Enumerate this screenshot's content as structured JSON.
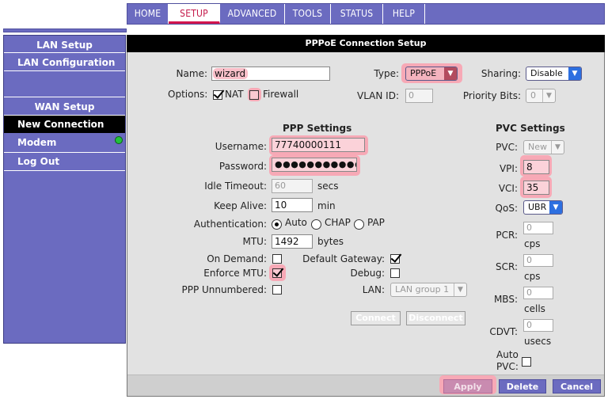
{
  "topnav": {
    "tabs": [
      {
        "label": "HOME"
      },
      {
        "label": "SETUP"
      },
      {
        "label": "ADVANCED"
      },
      {
        "label": "TOOLS"
      },
      {
        "label": "STATUS"
      },
      {
        "label": "HELP"
      }
    ],
    "active_tab": "SETUP"
  },
  "sidebar": {
    "lan_heading": "LAN Setup",
    "lan_configuration": "LAN Configuration",
    "wan_heading": "WAN Setup",
    "new_connection": "New Connection",
    "modem": "Modem",
    "log_out": "Log Out",
    "modem_status_color": "#21c23b"
  },
  "panel": {
    "title": "PPPoE Connection Setup",
    "name_label": "Name:",
    "name_value": "wizard",
    "type_label": "Type:",
    "type_value": "PPPoE",
    "sharing_label": "Sharing:",
    "sharing_value": "Disable",
    "options_label": "Options:",
    "nat_label": "NAT",
    "firewall_label": "Firewall",
    "vlan_label": "VLAN ID:",
    "vlan_value": "0",
    "priority_label": "Priority Bits:",
    "priority_value": "0"
  },
  "ppp": {
    "heading": "PPP Settings",
    "username_label": "Username:",
    "username_value": "77740000111",
    "password_label": "Password:",
    "password_value": "●●●●●●●●●●●",
    "idle_label": "Idle Timeout:",
    "idle_value": "60",
    "idle_unit": "secs",
    "keepalive_label": "Keep Alive:",
    "keepalive_value": "10",
    "keepalive_unit": "min",
    "auth_label": "Authentication:",
    "auth_auto": "Auto",
    "auth_chap": "CHAP",
    "auth_pap": "PAP",
    "mtu_label": "MTU:",
    "mtu_value": "1492",
    "mtu_unit": "bytes",
    "on_demand_label": "On Demand:",
    "default_gateway_label": "Default Gateway:",
    "enforce_mtu_label": "Enforce MTU:",
    "debug_label": "Debug:",
    "unnumbered_label": "PPP Unnumbered:",
    "lan_label": "LAN:",
    "lan_value": "LAN group 1",
    "connect": "Connect",
    "disconnect": "Disconnect"
  },
  "pvc": {
    "heading": "PVC Settings",
    "pvc_label": "PVC:",
    "pvc_value": "New",
    "vpi_label": "VPI:",
    "vpi_value": "8",
    "vci_label": "VCI:",
    "vci_value": "35",
    "qos_label": "QoS:",
    "qos_value": "UBR",
    "pcr_label": "PCR:",
    "pcr_value": "0",
    "pcr_unit": "cps",
    "scr_label": "SCR:",
    "scr_value": "0",
    "scr_unit": "cps",
    "mbs_label": "MBS:",
    "mbs_value": "0",
    "mbs_unit": "cells",
    "cdvt_label": "CDVT:",
    "cdvt_value": "0",
    "cdvt_unit": "usecs",
    "auto_pvc_label_1": "Auto",
    "auto_pvc_label_2": "PVC:"
  },
  "footer": {
    "apply": "Apply",
    "delete": "Delete",
    "cancel": "Cancel"
  },
  "colors": {
    "nav": "#6b6bc0",
    "active_tab": "#c4194a",
    "highlight": "#f7a9b6",
    "header": "#000000"
  }
}
